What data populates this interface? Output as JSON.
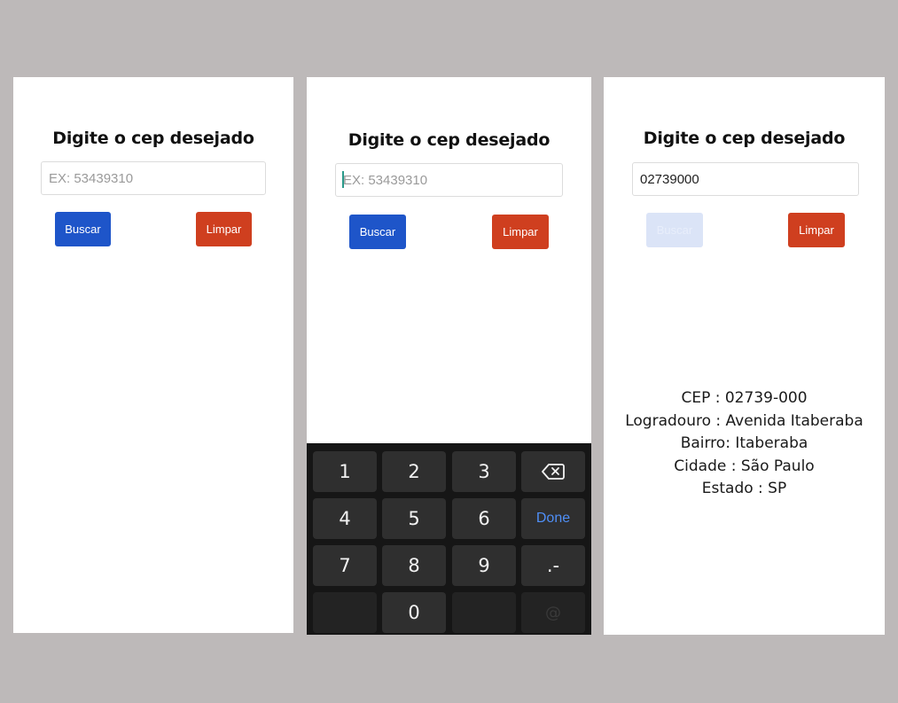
{
  "screens": [
    {
      "title": "Digite o cep desejado",
      "input": {
        "value": "",
        "placeholder": "EX: 53439310"
      },
      "search_label": "Buscar",
      "clear_label": "Limpar"
    },
    {
      "title": "Digite o cep desejado",
      "input": {
        "value": "",
        "placeholder": "EX: 53439310"
      },
      "search_label": "Buscar",
      "clear_label": "Limpar",
      "keyboard": {
        "keys": [
          "1",
          "2",
          "3",
          "4",
          "5",
          "6",
          "Done",
          "7",
          "8",
          "9",
          ".-",
          "0",
          "@"
        ],
        "backspace_icon": "backspace-icon"
      }
    },
    {
      "title": "Digite o cep desejado",
      "input": {
        "value": "02739000",
        "placeholder": "EX: 53439310"
      },
      "search_label": "Buscar",
      "clear_label": "Limpar",
      "result": {
        "cep": "CEP : 02739-000",
        "logradouro": "Logradouro : Avenida Itaberaba",
        "bairro": "Bairro: Itaberaba",
        "cidade": "Cidade : São Paulo",
        "estado": "Estado : SP"
      }
    }
  ],
  "colors": {
    "background": "#bdb9b9",
    "search_button": "#1e55c9",
    "clear_button": "#cf3f1f",
    "search_button_disabled": "#dbe4f7",
    "keyboard": "#161616",
    "done_key": "#4f8ff7"
  }
}
